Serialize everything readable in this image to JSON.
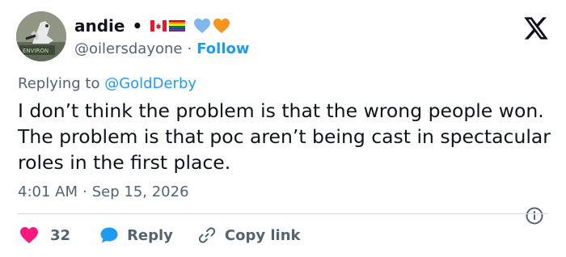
{
  "author": {
    "name": "andie",
    "separator_dot": "•",
    "handle": "@oilersdayone",
    "handle_separator": "·",
    "follow_label": "Follow",
    "avatar_text": "ENVIRON"
  },
  "reply_context": {
    "prefix": "Replying to",
    "mention": "@GoldDerby"
  },
  "tweet": {
    "text": "I don’t think the problem is that the wrong people won. The problem is that poc aren’t being cast in spectacular roles in the first place."
  },
  "meta": {
    "time": "4:01 AM",
    "separator": "·",
    "date": "Sep 15, 2026"
  },
  "actions": {
    "like_count": "32",
    "reply_label": "Reply",
    "copy_label": "Copy link"
  },
  "icons": {
    "logo": "x-logo-icon",
    "info": "info-icon",
    "like": "heart-icon",
    "reply": "reply-bubble-icon",
    "copy": "link-icon",
    "flag_canada": "canada-flag-icon",
    "flag_pride": "pride-flag-icon",
    "heart_blue": "blue-heart-icon",
    "heart_orange": "orange-heart-icon"
  },
  "colors": {
    "accent": "#1d9bf0",
    "like": "#f91880",
    "secondary_text": "#536471",
    "primary_text": "#0f1419"
  }
}
